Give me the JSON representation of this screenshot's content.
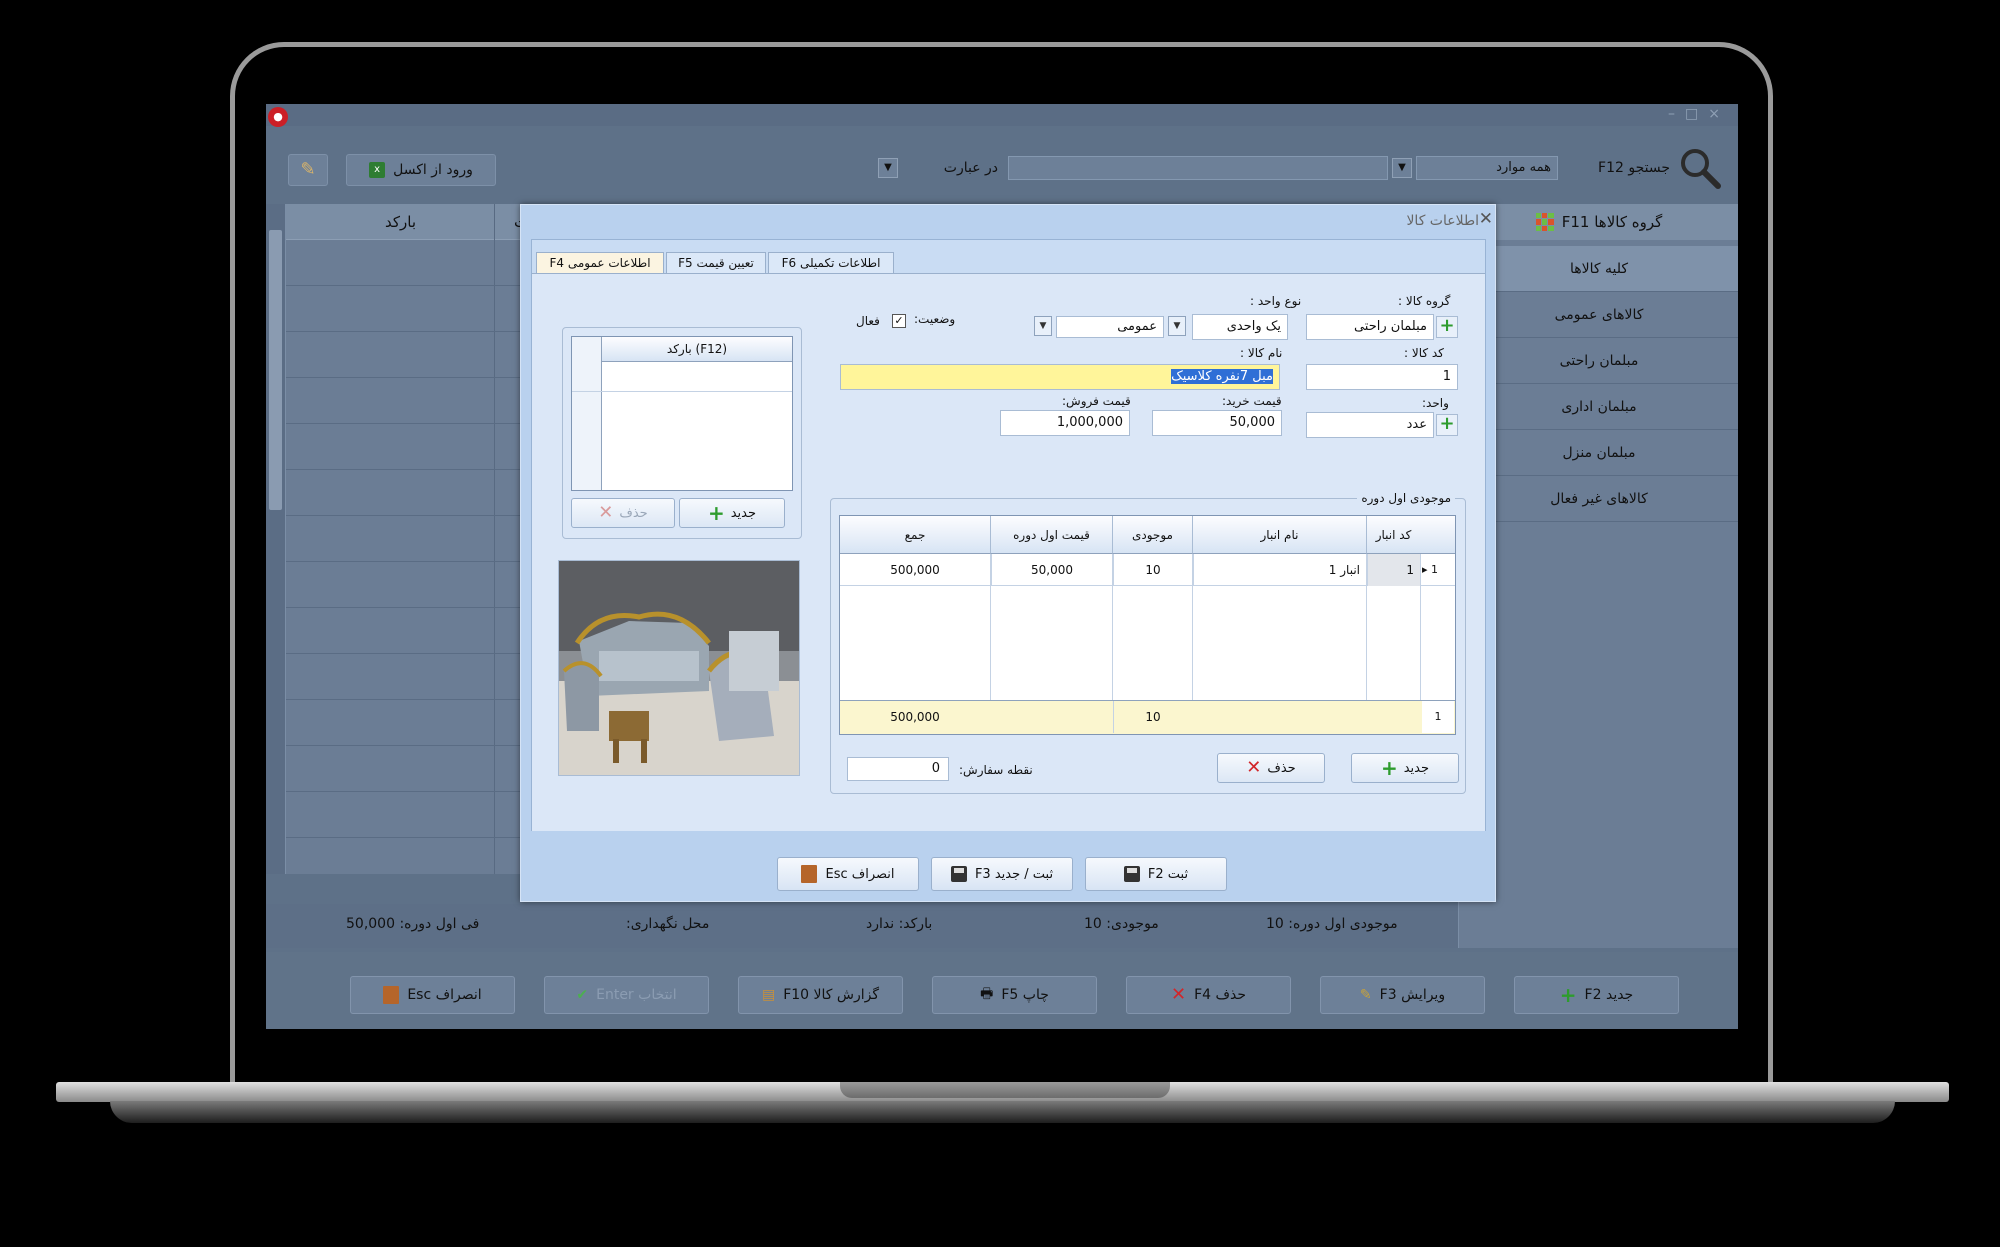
{
  "toolbar": {
    "excel_import_label": "ورود از اکسل",
    "match_mode": "در عبارت",
    "scope_value": "همه موارد",
    "search_label": "جستجو F12"
  },
  "grid": {
    "col_barcode": "بارکد",
    "col_partial": "ت"
  },
  "groups": {
    "header": "گروه کالاها F11",
    "items": [
      "کلیه کالاها",
      "کالاهای عمومی",
      "مبلمان راحتی",
      "مبلمان اداری",
      "مبلمان منزل",
      "کالاهای غیر فعال"
    ]
  },
  "status": {
    "opening_stock": "موجودی اول دوره: 10",
    "stock": "موجودی: 10",
    "barcode": "بارکد: ندارد",
    "storage": "محل نگهداری:",
    "opening_price": "فی اول دوره: 50,000"
  },
  "bottom_buttons": {
    "new": "جدید F2",
    "edit": "ویرایش F3",
    "delete": "حذف F4",
    "print": "چاپ F5",
    "report": "گزارش کالا F10",
    "select": "انتخاب Enter",
    "cancel": "انصراف Esc"
  },
  "dialog": {
    "title": "اطلاعات کالا",
    "tabs": {
      "general": "اطلاعات عمومی F4",
      "pricing": "تعیین قیمت F5",
      "extra": "اطلاعات تکمیلی F6"
    },
    "barcode_col": "(F12) بارکد",
    "barcode_new": "جدید",
    "barcode_delete": "حذف",
    "group_label": "گروه کالا :",
    "group_value": "مبلمان راحتی",
    "unit_type_label": "نوع واحد :",
    "unit_type_value": "یک واحدی",
    "unit_type_sub": "عمومی",
    "status_label": "وضعیت:",
    "active_label": "فعال",
    "active_checked": "✓",
    "code_label": "کد کالا :",
    "code_value": "1",
    "name_label": "نام کالا :",
    "name_value": "مبل 7نفره کلاسیک",
    "unit_label": "واحد:",
    "unit_value": "عدد",
    "buy_price_label": "قیمت خرید:",
    "buy_price_value": "50,000",
    "sell_price_label": "قیمت فروش:",
    "sell_price_value": "1,000,000",
    "inventory_legend": "موجودی اول دوره",
    "inv_headers": {
      "code": "کد انبار",
      "name": "نام انبار",
      "qty": "موجودی",
      "price": "قیمت اول دوره",
      "sum": "جمع"
    },
    "inv_row": {
      "marker": "▸",
      "rownum": "1",
      "code": "1",
      "name": "انبار 1",
      "qty": "10",
      "price": "50,000",
      "sum": "500,000"
    },
    "inv_total": {
      "rownum": "1",
      "qty": "10",
      "sum": "500,000"
    },
    "inv_new": "جدید",
    "inv_delete": "حذف",
    "order_point_label": "نقطه سفارش:",
    "order_point_value": "0",
    "footer": {
      "save": "ثبت F2",
      "save_new": "ثبت / جدید F3",
      "cancel": "انصراف Esc"
    }
  },
  "colors": {
    "screen_bg": "#5e7188",
    "dialog_bg": "#b9d1ee",
    "highlight_yellow": "#fff59a",
    "selection_blue": "#2f6fd6"
  }
}
